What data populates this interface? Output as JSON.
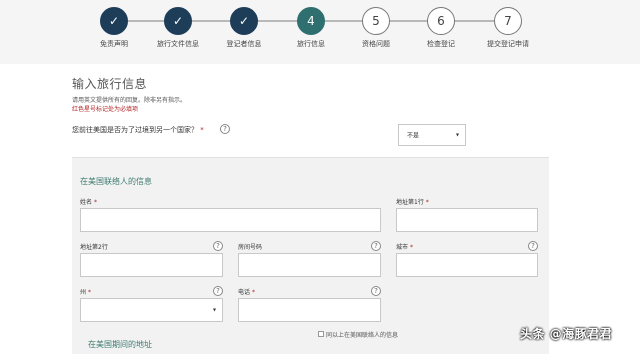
{
  "steps": [
    {
      "icon": "✓",
      "label": "免责声明",
      "state": "done"
    },
    {
      "icon": "✓",
      "label": "旅行文件信息",
      "state": "done"
    },
    {
      "icon": "✓",
      "label": "登记者信息",
      "state": "done"
    },
    {
      "icon": "4",
      "label": "旅行信息",
      "state": "current"
    },
    {
      "icon": "5",
      "label": "资格问题",
      "state": "todo"
    },
    {
      "icon": "6",
      "label": "检查登记",
      "state": "todo"
    },
    {
      "icon": "7",
      "label": "提交登记申请",
      "state": "todo"
    }
  ],
  "page": {
    "title": "输入旅行信息",
    "intro_line1": "请用英文提供所有的回复。除非另有指示。",
    "intro_line2": "红色星号标记处为必填项"
  },
  "transit_question": {
    "label": "您前往美国是否为了过境到另一个国家？",
    "required_mark": "*",
    "help_icon": "?",
    "select_value": "不是",
    "select_arrow": "▾"
  },
  "us_contact": {
    "section_title": "在美国联络人的信息",
    "fields": {
      "name": {
        "label": "姓名",
        "required_mark": "*"
      },
      "address1": {
        "label": "地址第1行",
        "required_mark": "*"
      },
      "address2": {
        "label": "地址第2行"
      },
      "apartment": {
        "label": "房间号码"
      },
      "city": {
        "label": "城市",
        "required_mark": "*"
      },
      "state": {
        "label": "州",
        "required_mark": "*",
        "select_arrow": "▾"
      },
      "phone": {
        "label": "电话",
        "required_mark": "*"
      }
    },
    "help_icon": "?"
  },
  "same_as_contact_label": "同以上在美国联络人的信息",
  "us_stay_section_title": "在美国期间的地址",
  "watermark": "头条 @海豚君君",
  "colors": {
    "done": "#1e3d59",
    "current": "#2f6f6f",
    "required": "#b22222",
    "section_title": "#3d7a70"
  }
}
